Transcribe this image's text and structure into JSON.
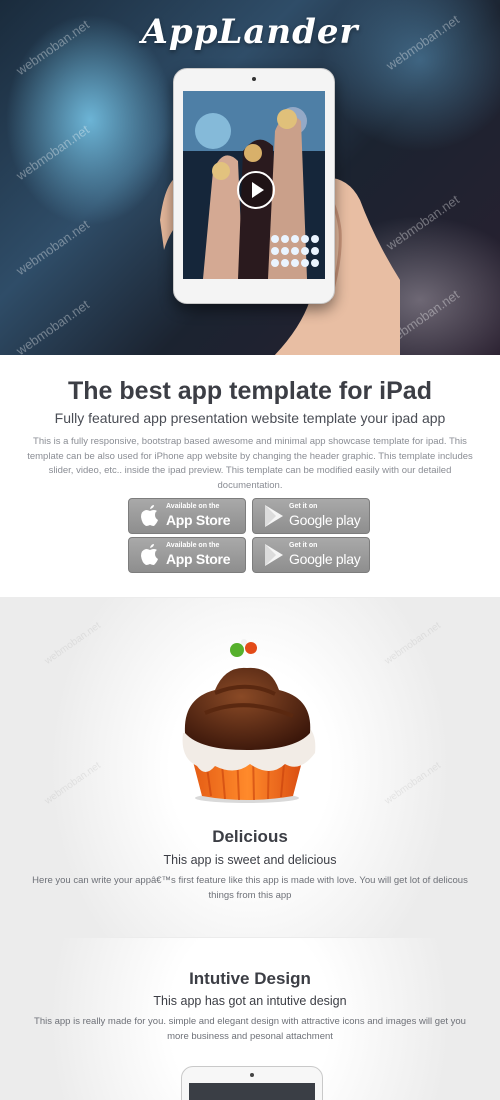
{
  "hero": {
    "brand": "AppLander",
    "play_icon": "play-icon",
    "watermark": "webmoban.net"
  },
  "intro": {
    "title": "The best app template for iPad",
    "subtitle": "Fully featured app presentation website template your ipad app",
    "description": "This is a fully responsive, bootstrap based awesome and minimal app showcase template for ipad. This template can be also used for iPhone app website by changing the header graphic. This template includes slider, video, etc.. inside the ipad preview. This template can be modified easily with our detailed documentation.",
    "buttons": [
      {
        "small": "Available on the",
        "big": "App Store",
        "icon": "apple-icon"
      },
      {
        "small": "Get it on",
        "big": "Google play",
        "icon": "google-play-icon"
      },
      {
        "small": "Available on the",
        "big": "App Store",
        "icon": "apple-icon"
      },
      {
        "small": "Get it on",
        "big": "Google play",
        "icon": "google-play-icon"
      }
    ]
  },
  "features": [
    {
      "title": "Delicious",
      "tagline": "This app is sweet and delicious",
      "text": "Here you can write your appâ€™s first feature like this app is made with love. You will get lot of delicous things from this app",
      "image": "cupcake-image"
    },
    {
      "title": "Intutive Design",
      "tagline": "This app has got an intutive design",
      "text": "This app is really made for you. simple and elegant design with attractive icons and images will get you more business and pesonal attachment",
      "image": "ipad-image"
    }
  ],
  "colors": {
    "heading": "#3c3e45",
    "button": "#999999",
    "body_text": "#8a8d94"
  }
}
